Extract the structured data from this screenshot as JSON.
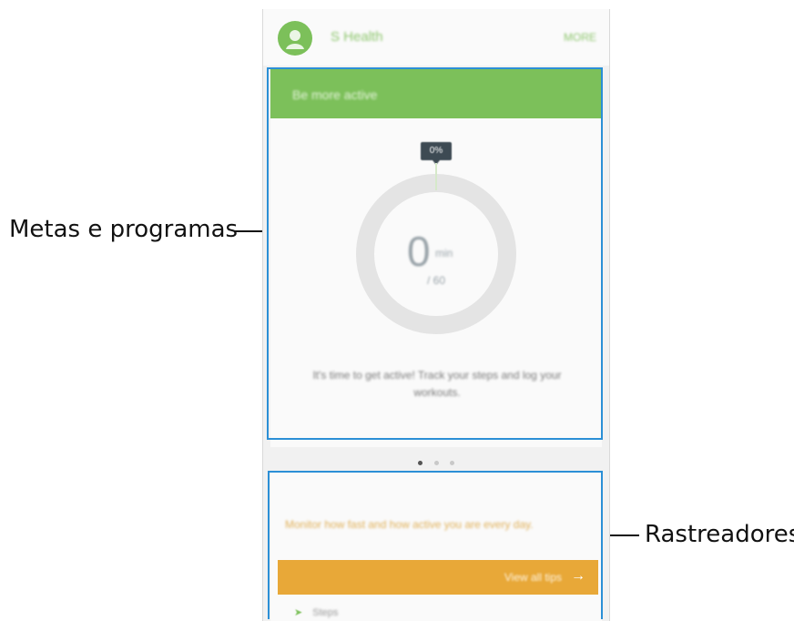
{
  "app": {
    "title": "S Health",
    "more_label": "MORE"
  },
  "goal_card": {
    "header": "Be more active",
    "badge": "0%",
    "value": "0",
    "unit": "min",
    "target": "/ 60",
    "message": "It's time to get active! Track your steps and log your workouts."
  },
  "pager": {
    "count": 3,
    "active": 0
  },
  "tracker_card": {
    "message": "Monitor how fast and how active you are every day.",
    "button_label": "View all tips",
    "button_icon": "arrow-right-icon",
    "partial_item": "Steps"
  },
  "callouts": {
    "left": "Metas e programas",
    "right": "Rastreadores"
  },
  "colors": {
    "green": "#7cc05a",
    "orange": "#e8a838",
    "highlight": "#2b8fd6"
  }
}
